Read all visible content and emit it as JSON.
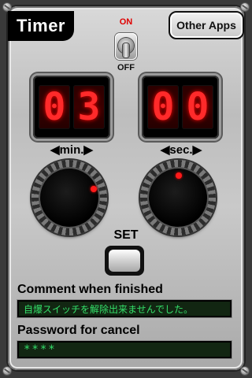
{
  "app": {
    "title": "Timer"
  },
  "header": {
    "other_apps_label": "Other Apps"
  },
  "power_switch": {
    "on_label": "ON",
    "off_label": "OFF"
  },
  "display": {
    "minutes": [
      "0",
      "3"
    ],
    "seconds": [
      "0",
      "0"
    ]
  },
  "controls": {
    "min_label": "◀min.▶",
    "sec_label": "◀sec.▶",
    "set_label": "SET"
  },
  "fields": {
    "comment_label": "Comment when finished",
    "comment_value": "自爆スイッチを解除出来ませんでした。",
    "password_label": "Password for cancel",
    "password_value": "****"
  },
  "colors": {
    "led": "#ff2a2a",
    "field_text": "#34e06a",
    "knob_indicator": "#ff1a1a"
  }
}
